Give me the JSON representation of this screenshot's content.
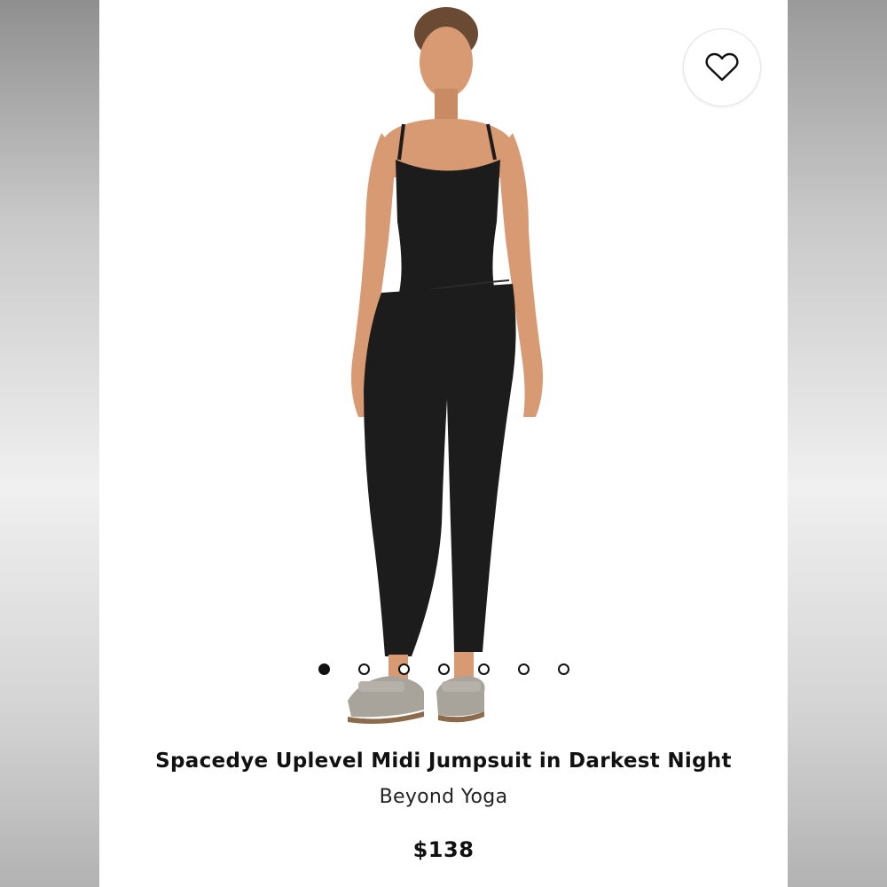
{
  "product": {
    "title": "Spacedye Uplevel Midi Jumpsuit in Darkest Night",
    "brand": "Beyond Yoga",
    "price": "$138"
  },
  "carousel": {
    "total_images": 7,
    "active_index": 0
  },
  "icons": {
    "favorite": "heart-outline-icon"
  },
  "colors": {
    "garment": "#1c1c1c",
    "skin": "#d89a72",
    "sandal": "#a8a39b",
    "text": "#111111"
  }
}
